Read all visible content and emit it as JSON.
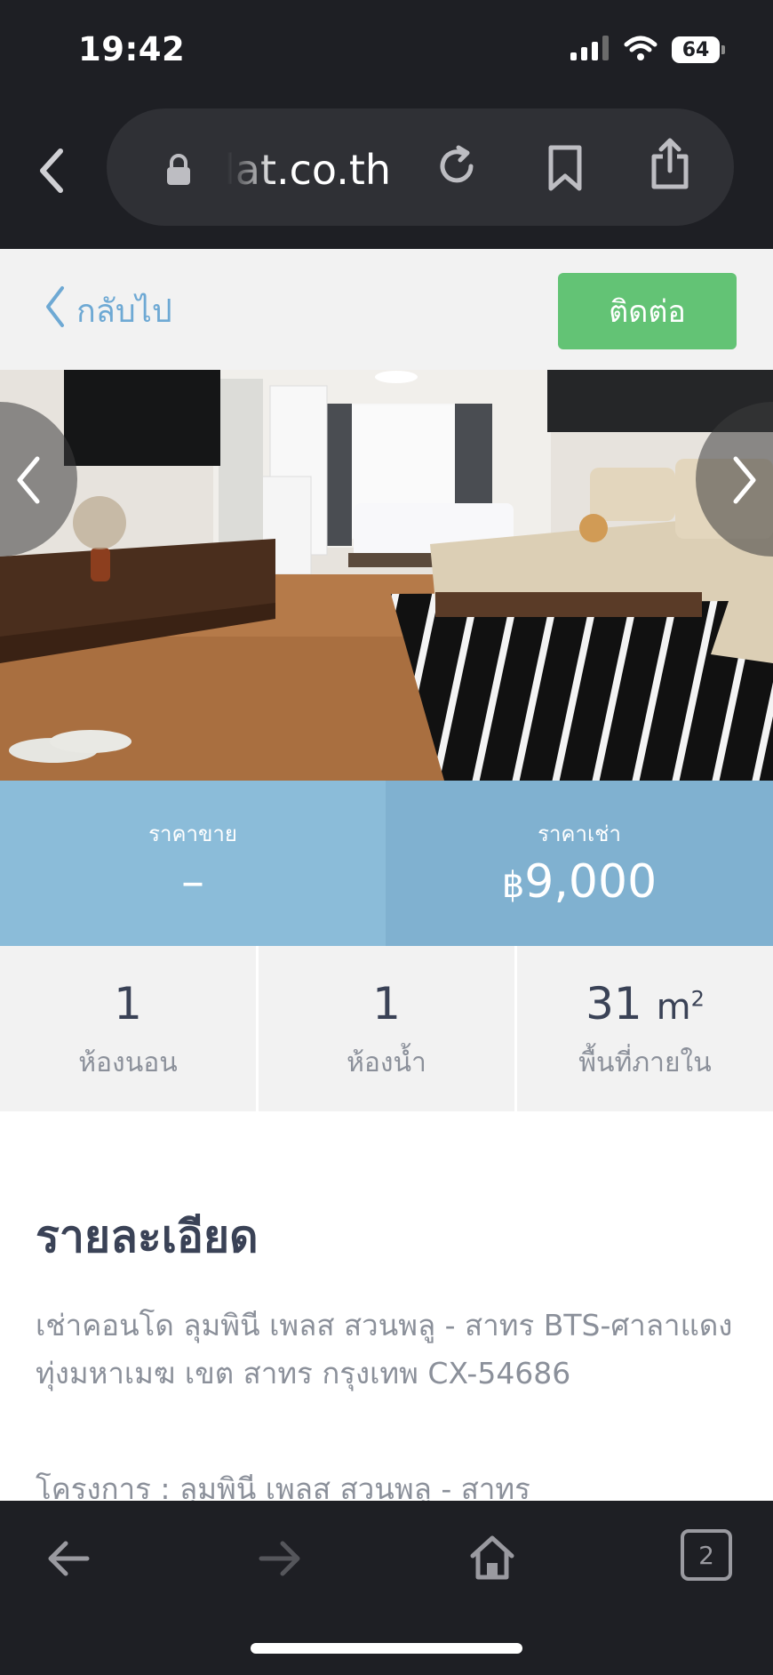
{
  "status": {
    "time": "19:42",
    "battery": "64"
  },
  "browser": {
    "url": "lat.co.th"
  },
  "header": {
    "back_label": "กลับไป",
    "contact_label": "ติดต่อ"
  },
  "price": {
    "sale_label": "ราคาขาย",
    "sale_value": "–",
    "rent_label": "ราคาเช่า",
    "currency": "฿",
    "rent_value": "9,000"
  },
  "stats": [
    {
      "value": "1",
      "label": "ห้องนอน"
    },
    {
      "value": "1",
      "label": "ห้องน้ำ"
    },
    {
      "value": "31",
      "unit": "m",
      "unit_sup": "2",
      "label": "พื้นที่ภายใน"
    }
  ],
  "details": {
    "title": "รายละเอียด",
    "body": "เช่าคอนโด ลุมพินี เพลส สวนพลู - สาทร BTS-ศาลาแดง ทุ่งมหาเมฆ เขต สาทร กรุงเทพ CX-54686",
    "extra": "โครงการ : ลุมพินี เพลส สวนพลู - สาทร"
  },
  "toolbar": {
    "tabs_count": "2"
  },
  "colors": {
    "contact": "#63c375",
    "link": "#6ea9d4",
    "price_bg": "#8bbcd9",
    "dark_chrome": "#1e1f24"
  }
}
